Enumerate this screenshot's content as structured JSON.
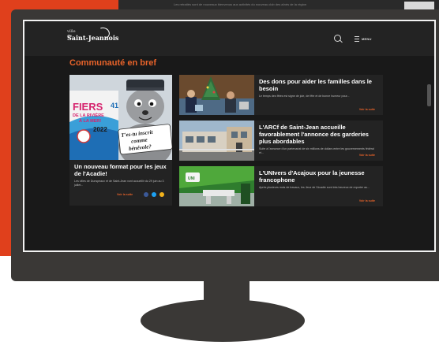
{
  "site": {
    "logo_pre": "ville de",
    "logo_name": "Saint-Jeannois",
    "menu_label": "MENU",
    "top_strip_text": "Les retraités sont de nouveaux bienvenus aux activités du nouveau club des aînés de la région"
  },
  "section": {
    "title": "Communauté en bref"
  },
  "featured": {
    "title": "Un nouveau format pour les jeux de l'Acadie!",
    "description": "Les villes de Dunspeaux et de Saint-Jean vont accueillir du 29 juin au 3 juillet...",
    "more_label": "Voir la suite",
    "poster": {
      "headline": "FIERS",
      "line2": "DE LA RIVIÈRE",
      "line3": "À LA MER!",
      "year": "2022",
      "number": "41",
      "sign": "T'es-tu inscrit comme bénévole?"
    },
    "share_icons": [
      "facebook-icon",
      "twitter-icon",
      "email-icon"
    ]
  },
  "articles": [
    {
      "title": "Des dons pour aider les familles dans le besoin",
      "description": "Le temps des fêtes est signe de joie, de fête et de bonne humeur pour...",
      "more_label": "Voir la suite"
    },
    {
      "title": "L'ARCf de Saint-Jean accueille favorablement l'annonce des garderies plus abordables",
      "description": "Suite à l'annonce d'un partenariat de six millions de dollars entre les gouvernements fédéral et...",
      "more_label": "Voir la suite"
    },
    {
      "title": "L'UNIvers d'Acajoux pour la jeunesse francophone",
      "description": "Après plusieurs mois de travaux, les Jeux de l'Acadie sont très heureux de reporter au...",
      "more_label": "Voir la suite"
    }
  ],
  "colors": {
    "accent": "#e8632a",
    "red_panel": "#e0401c",
    "screen_bg": "#191919",
    "card_bg": "#232323",
    "monitor": "#3a3836"
  }
}
